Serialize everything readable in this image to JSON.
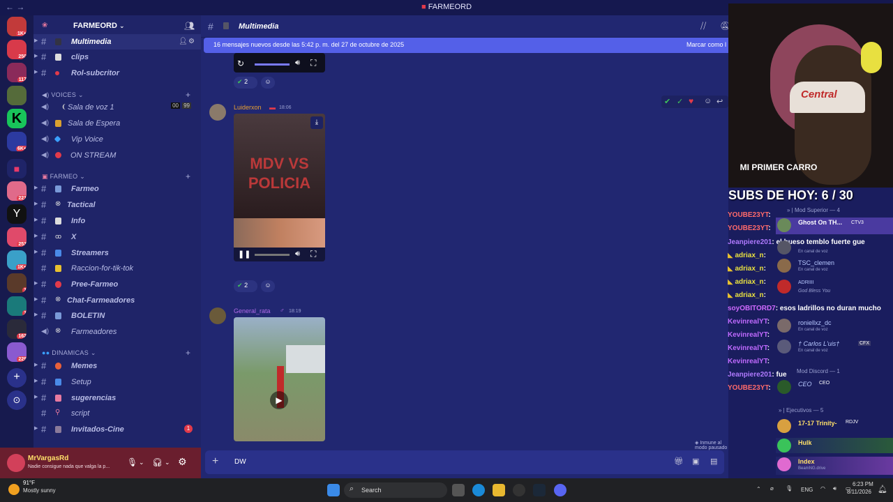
{
  "titlebar": {
    "title": "FARMEORD",
    "nav": "←  →"
  },
  "servers": [
    {
      "count": "1K+"
    },
    {
      "count": "250"
    },
    {
      "count": "117"
    },
    {
      "count": ""
    },
    {
      "count": ""
    },
    {
      "count": "6K+"
    },
    {
      "count": ""
    },
    {
      "count": "221"
    },
    {
      "count": ""
    },
    {
      "count": "253"
    },
    {
      "count": "1K+"
    },
    {
      "count": "1"
    },
    {
      "count": "1"
    },
    {
      "count": "162"
    },
    {
      "count": "229"
    }
  ],
  "sidebar": {
    "server_name": "FARMEORD",
    "channels_top": [
      {
        "name": "Multimedia"
      },
      {
        "name": "clips"
      },
      {
        "name": "Rol-subcritor"
      }
    ],
    "voices_label": "VOICES",
    "voices": [
      {
        "name": "Sala de voz 1",
        "count1": "00",
        "count2": "99"
      },
      {
        "name": "Sala de Espera"
      },
      {
        "name": "Vip Voice"
      },
      {
        "name": "ON STREAM"
      }
    ],
    "farmeo_label": "FARMEO",
    "farmeo": [
      {
        "name": "Farmeo"
      },
      {
        "name": "Tactical"
      },
      {
        "name": "Info"
      },
      {
        "name": "X"
      },
      {
        "name": "Streamers"
      },
      {
        "name": "Raccion-for-tik-tok"
      },
      {
        "name": "Pree-Farmeo"
      },
      {
        "name": "Chat-Farmeadores"
      },
      {
        "name": "BOLETIN"
      },
      {
        "name": "Farmeadores"
      }
    ],
    "dinamicas_label": "DINAMICAS",
    "dinamicas": [
      {
        "name": "Memes"
      },
      {
        "name": "Setup"
      },
      {
        "name": "sugerencias"
      },
      {
        "name": "script"
      },
      {
        "name": "Invitados-Cine",
        "badge": "1"
      }
    ]
  },
  "user": {
    "name": "MrVargasRd",
    "status": "Nadie consigue nada que valga la p..."
  },
  "channel": {
    "name": "Multimedia"
  },
  "banner": {
    "text": "16 mensajes nuevos desde las 5:42 p. m. del 27 de octubre de 2025",
    "mark": "Marcar como l"
  },
  "messages": [
    {
      "author": "Luiderxon",
      "time": "18:06",
      "reaction_count": "2",
      "video_text": "MDV VS POLICIA"
    },
    {
      "author": "General_rata",
      "time": "18:19"
    }
  ],
  "top_reaction_count": "2",
  "composer": {
    "text": "DW"
  },
  "paused": "Inmune al modo pausado",
  "stream": {
    "subs": "SUBS DE HOY: 6 / 30",
    "overlay": "MI PRIMER CARRO",
    "cap": "Central"
  },
  "chat": [
    {
      "user": "YOUBE23YT",
      "msg": ":"
    },
    {
      "user": "YOUBE23YT",
      "msg": ":"
    },
    {
      "user": "Jeanpiere201",
      "msg": ": el hueso temblo fuerte gue"
    },
    {
      "user": "adriax_n",
      "msg": ":"
    },
    {
      "user": "adriax_n",
      "msg": ":"
    },
    {
      "user": "adriax_n",
      "msg": ":"
    },
    {
      "user": "adriax_n",
      "msg": ":"
    },
    {
      "user": "soyOBITORD7",
      "msg": ": esos ladrillos no duran mucho"
    },
    {
      "user": "KevinrealYT",
      "msg": ":"
    },
    {
      "user": "KevinrealYT",
      "msg": ":"
    },
    {
      "user": "KevinrealYT",
      "msg": ":"
    },
    {
      "user": "KevinrealYT",
      "msg": ":"
    },
    {
      "user": "Jeanpiere201",
      "msg": ": fue"
    },
    {
      "user": "YOUBE23YT",
      "msg": ":"
    }
  ],
  "members": {
    "mod_superior": "» | Mod Superior — 4",
    "mod_discord": "Mod Discord — 1",
    "ejecutivos": "» | Ejecutivos — 5",
    "list": [
      {
        "name": "Ghost On TH...",
        "tag": "CTV3",
        "status": ""
      },
      {
        "name": "",
        "tag": "",
        "status": "En canal de voz"
      },
      {
        "name": "TSC_clemen",
        "tag": "",
        "status": "En canal de voz"
      },
      {
        "name": "ADRIIII",
        "tag": "",
        "status": "God Bless You"
      },
      {
        "name": "roniellxz_dc",
        "tag": "",
        "status": "En canal de voz"
      },
      {
        "name": "† Carlos L'uis†",
        "tag": "CFX",
        "status": "En canal de voz"
      },
      {
        "name": "CEO",
        "tag": "CEO",
        "status": ""
      },
      {
        "name": "17-17 Trinity-",
        "tag": "RDJV",
        "status": ""
      },
      {
        "name": "Hulk",
        "tag": "",
        "status": ""
      },
      {
        "name": "Index",
        "tag": "",
        "status": "BeamNG.drive"
      }
    ]
  },
  "taskbar": {
    "temp": "91°F",
    "weather": "Mostly sunny",
    "search": "Search",
    "lang": "ENG",
    "time": "6:23 PM",
    "date": "8/11/2026"
  }
}
